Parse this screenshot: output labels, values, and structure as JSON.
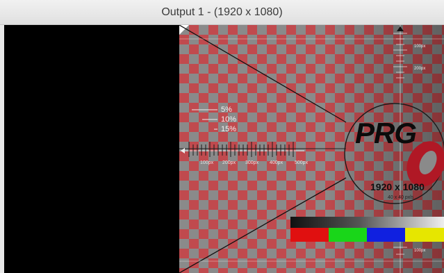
{
  "window": {
    "title": "Output 1 -  (1920 x 1080)"
  },
  "test_pattern": {
    "logo_text": "PRG",
    "resolution_text": "1920 x 1080",
    "pixel_label": "40 x 40 pxls",
    "percent_labels": [
      "5%",
      "10%",
      "15%"
    ],
    "ruler_labels": [
      "100px",
      "200px",
      "300px",
      "400px",
      "500px"
    ],
    "side_labels": [
      "100px",
      "200px",
      "100px"
    ],
    "colors": {
      "checker_red": "#c04a4e",
      "checker_gray": "#8a8a8a",
      "bar_red": "#e01010",
      "bar_green": "#19d619",
      "bar_blue": "#1020e0",
      "bar_yellow": "#e6e600"
    }
  }
}
